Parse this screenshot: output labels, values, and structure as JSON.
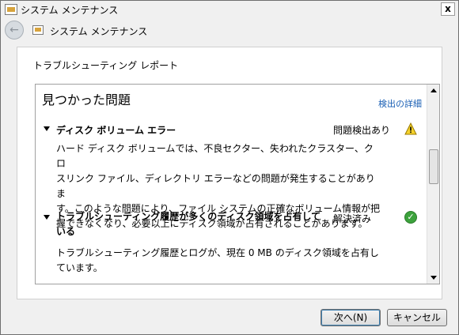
{
  "window": {
    "title": "システム メンテナンス",
    "close_label": "x"
  },
  "nav": {
    "title": "システム メンテナンス",
    "back_glyph": "←"
  },
  "panel": {
    "heading": "トラブルシューティング レポート",
    "section_title": "見つかった問題",
    "details_link": "検出の詳細"
  },
  "issues": [
    {
      "title": "ディスク ボリューム エラー",
      "status": "問題検出あり",
      "icon": "warning-icon",
      "desc_lines": [
        "ハード ディスク ボリュームでは、不良セクター、失われたクラスター、クロ",
        "スリンク ファイル、ディレクトリ エラーなどの問題が発生することがありま",
        "す。このような問題により、ファイル システムの正確なボリューム情報が把",
        "握できなくなり、必要以上にディスク領域が占有されることがあります。"
      ]
    },
    {
      "title_lines": [
        "トラブルシューティング履歴が多くのディスク領域を占有して",
        "いる"
      ],
      "status": "解決済み",
      "icon": "check-icon",
      "desc_lines": [
        "トラブルシューティング履歴とログが、現在 0 MB のディスク領域を占有し",
        "ています。"
      ]
    }
  ],
  "buttons": {
    "next": "次へ(N)",
    "cancel": "キャンセル"
  }
}
